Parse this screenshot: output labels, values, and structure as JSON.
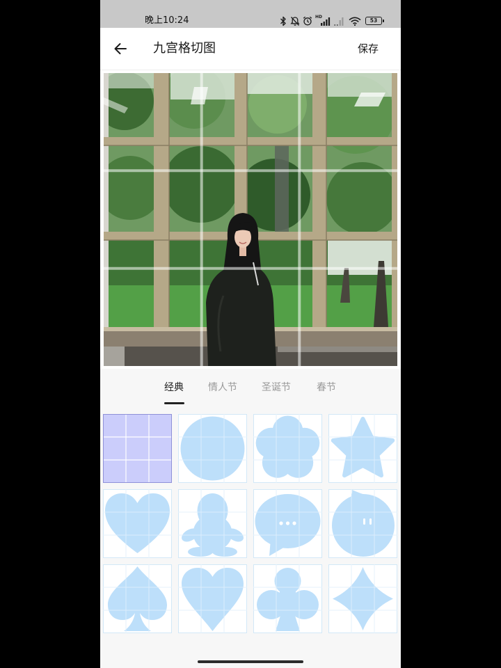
{
  "status_bar": {
    "time": "晚上10:24",
    "network_label": "HD",
    "battery_level": "53",
    "icons": [
      "bluetooth-icon",
      "mute-icon",
      "alarm-icon",
      "signal-icon",
      "signal-weak-icon",
      "wifi-icon",
      "battery-icon"
    ]
  },
  "app_bar": {
    "back_icon": "back-arrow-icon",
    "title": "九宫格切图",
    "save_label": "保存"
  },
  "tabs": {
    "selected": 0,
    "items": [
      {
        "label": "经典"
      },
      {
        "label": "情人节"
      },
      {
        "label": "圣诞节"
      },
      {
        "label": "春节"
      }
    ]
  },
  "shapes": {
    "selected": 0,
    "items": [
      {
        "icon": "grid-icon"
      },
      {
        "icon": "circle-icon"
      },
      {
        "icon": "flower-icon"
      },
      {
        "icon": "star-icon"
      },
      {
        "icon": "heart-icon"
      },
      {
        "icon": "penguin-icon"
      },
      {
        "icon": "chat-bubble-icon"
      },
      {
        "icon": "qq-bubble-icon"
      },
      {
        "icon": "spade-icon"
      },
      {
        "icon": "heart-pointed-icon"
      },
      {
        "icon": "club-icon"
      },
      {
        "icon": "diamond-icon"
      }
    ]
  },
  "colors": {
    "status_bar_bg": "#c8c8c8",
    "page_bg": "#f7f7f7",
    "tab_active": "#222222",
    "tab_inactive": "#999999",
    "shape_fill": "#bddffa",
    "grid_line": "#d2e8f7",
    "selected_fill": "#cbcdfb",
    "selected_border": "#8f91d8"
  }
}
